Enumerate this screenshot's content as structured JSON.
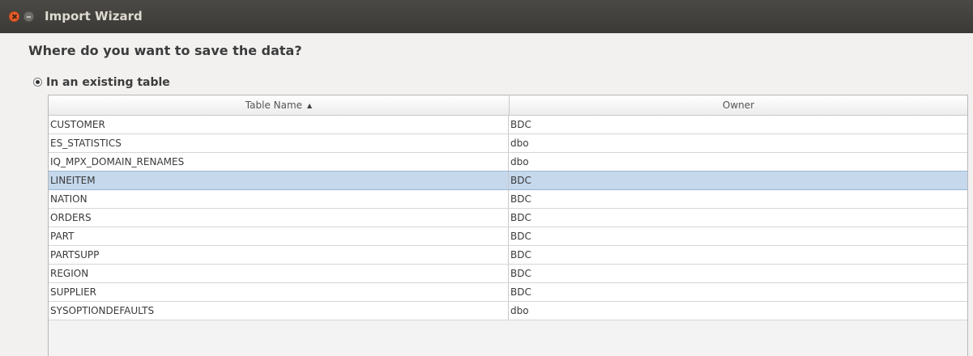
{
  "window": {
    "title": "Import Wizard"
  },
  "main": {
    "question": "Where do you want to save the data?",
    "option_existing_table": "In an existing table"
  },
  "table": {
    "columns": [
      "Table Name",
      "Owner"
    ],
    "sort": {
      "column": "Table Name",
      "direction": "ascending"
    },
    "selected_row": 3,
    "rows": [
      {
        "name": "CUSTOMER",
        "owner": "BDC"
      },
      {
        "name": "ES_STATISTICS",
        "owner": "dbo"
      },
      {
        "name": "IQ_MPX_DOMAIN_RENAMES",
        "owner": "dbo"
      },
      {
        "name": "LINEITEM",
        "owner": "BDC"
      },
      {
        "name": "NATION",
        "owner": "BDC"
      },
      {
        "name": "ORDERS",
        "owner": "BDC"
      },
      {
        "name": "PART",
        "owner": "BDC"
      },
      {
        "name": "PARTSUPP",
        "owner": "BDC"
      },
      {
        "name": "REGION",
        "owner": "BDC"
      },
      {
        "name": "SUPPLIER",
        "owner": "BDC"
      },
      {
        "name": "SYSOPTIONDEFAULTS",
        "owner": "dbo"
      }
    ]
  },
  "colors": {
    "titlebar": "#3b3a37",
    "close_button": "#e6602c",
    "selection": "#c5d8ec"
  },
  "icons": [
    "close-icon",
    "minimize-icon",
    "radio-selected-icon",
    "sort-ascending-icon"
  ]
}
